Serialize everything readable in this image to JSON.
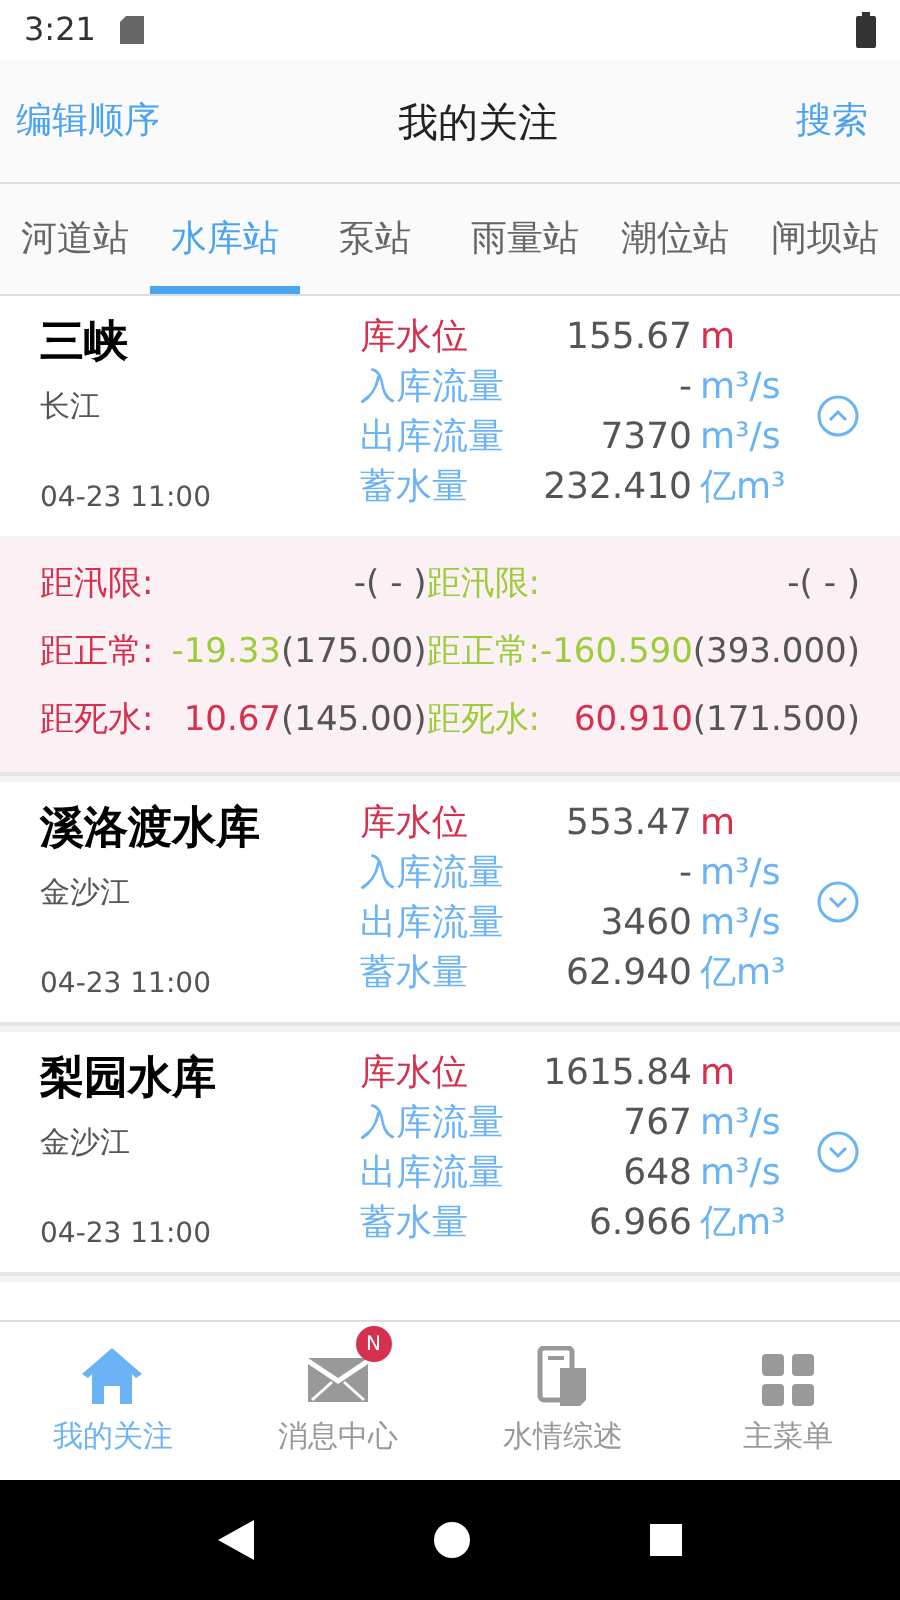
{
  "status_bar": {
    "time": "3:21"
  },
  "header": {
    "left_action": "编辑顺序",
    "title": "我的关注",
    "right_action": "搜索"
  },
  "tabs": [
    {
      "label": "河道站",
      "selected": false
    },
    {
      "label": "水库站",
      "selected": true
    },
    {
      "label": "泵站",
      "selected": false
    },
    {
      "label": "雨量站",
      "selected": false
    },
    {
      "label": "潮位站",
      "selected": false
    },
    {
      "label": "闸坝站",
      "selected": false
    }
  ],
  "cards": [
    {
      "name": "三峡",
      "river": "长江",
      "time": "04-23 11:00",
      "expanded": true,
      "metrics": [
        {
          "kind": "level",
          "label": "库水位",
          "value": "155.67",
          "unit": "m"
        },
        {
          "kind": "flow",
          "label": "入库流量",
          "value": "-",
          "unit": "m³/s"
        },
        {
          "kind": "flow",
          "label": "出库流量",
          "value": "7370",
          "unit": "m³/s"
        },
        {
          "kind": "flow",
          "label": "蓄水量",
          "value": "232.410",
          "unit": "亿m³"
        }
      ],
      "details": [
        {
          "color": "#d6304f",
          "rows": [
            {
              "label": "距汛限:",
              "value": "-",
              "base": "( - )",
              "kind": "none"
            },
            {
              "label": "距正常:",
              "value": "-19.33",
              "base": "(175.00)",
              "kind": "below"
            },
            {
              "label": "距死水:",
              "value": "10.67",
              "base": "(145.00)",
              "kind": "above"
            }
          ]
        },
        {
          "color": "#9ccc3c",
          "rows": [
            {
              "label": "距汛限:",
              "value": "-",
              "base": "( - )",
              "kind": "none"
            },
            {
              "label": "距正常:",
              "value": "-160.590",
              "base": "(393.000)",
              "kind": "below"
            },
            {
              "label": "距死水:",
              "value": "60.910",
              "base": "(171.500)",
              "kind": "above"
            }
          ]
        }
      ]
    },
    {
      "name": "溪洛渡水库",
      "river": "金沙江",
      "time": "04-23 11:00",
      "expanded": false,
      "metrics": [
        {
          "kind": "level",
          "label": "库水位",
          "value": "553.47",
          "unit": "m"
        },
        {
          "kind": "flow",
          "label": "入库流量",
          "value": "-",
          "unit": "m³/s"
        },
        {
          "kind": "flow",
          "label": "出库流量",
          "value": "3460",
          "unit": "m³/s"
        },
        {
          "kind": "flow",
          "label": "蓄水量",
          "value": "62.940",
          "unit": "亿m³"
        }
      ]
    },
    {
      "name": "梨园水库",
      "river": "金沙江",
      "time": "04-23 11:00",
      "expanded": false,
      "metrics": [
        {
          "kind": "level",
          "label": "库水位",
          "value": "1615.84",
          "unit": "m"
        },
        {
          "kind": "flow",
          "label": "入库流量",
          "value": "767",
          "unit": "m³/s"
        },
        {
          "kind": "flow",
          "label": "出库流量",
          "value": "648",
          "unit": "m³/s"
        },
        {
          "kind": "flow",
          "label": "蓄水量",
          "value": "6.966",
          "unit": "亿m³"
        }
      ]
    }
  ],
  "bottom_nav": [
    {
      "kind": "home",
      "label": "我的关注",
      "selected": true
    },
    {
      "kind": "mail",
      "label": "消息中心",
      "selected": false,
      "badge": "N"
    },
    {
      "kind": "doc",
      "label": "水情综述",
      "selected": false
    },
    {
      "kind": "grid",
      "label": "主菜单",
      "selected": false
    }
  ]
}
